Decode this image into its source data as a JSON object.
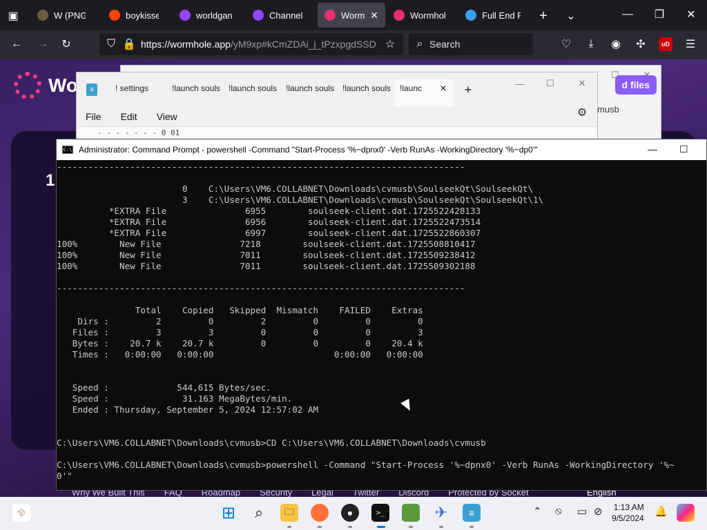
{
  "browser": {
    "tabs": [
      {
        "label": "W (PNG Im",
        "color": "#6b5b3e"
      },
      {
        "label": "boykisser",
        "color": "#ff4500"
      },
      {
        "label": "worldgan",
        "color": "#9146ff"
      },
      {
        "label": "Channel -",
        "color": "#9146ff"
      },
      {
        "label": "Wormh",
        "color": "#e8306f",
        "active": true
      },
      {
        "label": "Wormhole",
        "color": "#e8306f"
      },
      {
        "label": "Full End P",
        "color": "#3aa0e8"
      }
    ],
    "url_main": "https://wormhole.app",
    "url_rest": "/yM9xp#kCmZDAi_j_tPzxpgdSSD",
    "search_placeholder": "Search",
    "extension_badge": "uD"
  },
  "page": {
    "logo_text": "Wo",
    "upload_button": "d files",
    "card_number": "1",
    "musb_label": "musb",
    "footer_links": [
      "Why We Built This",
      "FAQ",
      "Roadmap",
      "Security",
      "Legal",
      "Twitter",
      "Discord",
      "Protected by Socket"
    ],
    "language": "English"
  },
  "notepad": {
    "tabs": [
      "! settings",
      "!launch souls",
      "!launch souls",
      "!launch souls",
      "!launch souls"
    ],
    "active_tab": "!launc",
    "menu": [
      "File",
      "Edit",
      "View"
    ],
    "peek_text": "-  -  -  -  -  -  - 0 01"
  },
  "cmd": {
    "title": "Administrator: Command Prompt - powershell  -Command \"Start-Process '%~dpnx0' -Verb RunAs -WorkingDirectory '%~dp0'\"",
    "lines": [
      "------------------------------------------------------------------------------",
      "",
      "                        0    C:\\Users\\VM6.COLLABNET\\Downloads\\cvmusb\\SoulseekQt\\SoulseekQt\\",
      "                        3    C:\\Users\\VM6.COLLABNET\\Downloads\\cvmusb\\SoulseekQt\\SoulseekQt\\1\\",
      "          *EXTRA File               6955        soulseek-client.dat.1725522428133",
      "          *EXTRA File               6956        soulseek-client.dat.1725522473514",
      "          *EXTRA File               6997        soulseek-client.dat.1725522860307",
      "100%        New File               7218        soulseek-client.dat.1725508810417",
      "100%        New File               7011        soulseek-client.dat.1725509238412",
      "100%        New File               7011        soulseek-client.dat.1725509302188",
      "",
      "------------------------------------------------------------------------------",
      "",
      "               Total    Copied   Skipped  Mismatch    FAILED    Extras",
      "    Dirs :         2         0         2         0         0         0",
      "   Files :         3         3         0         0         0         3",
      "   Bytes :    20.7 k    20.7 k         0         0         0    20.4 k",
      "   Times :   0:00:00   0:00:00                       0:00:00   0:00:00",
      "",
      "",
      "   Speed :             544,615 Bytes/sec.",
      "   Speed :              31.163 MegaBytes/min.",
      "   Ended : Thursday, September 5, 2024 12:57:02 AM",
      "",
      "",
      "C:\\Users\\VM6.COLLABNET\\Downloads\\cvmusb>CD C:\\Users\\VM6.COLLABNET\\Downloads\\cvmusb",
      "",
      "C:\\Users\\VM6.COLLABNET\\Downloads\\cvmusb>powershell -Command \"Start-Process '%~dpnx0' -Verb RunAs -WorkingDirectory '%~",
      "0'\""
    ]
  },
  "taskbar": {
    "time": "1:13 AM",
    "date": "9/5/2024"
  }
}
